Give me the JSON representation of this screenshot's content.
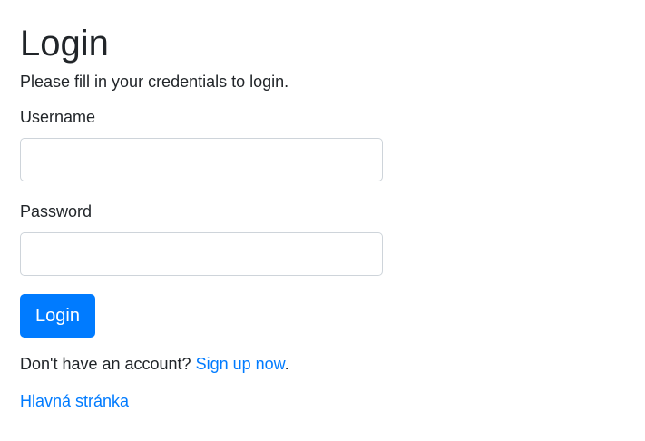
{
  "page": {
    "title": "Login",
    "subtitle": "Please fill in your credentials to login."
  },
  "form": {
    "username_label": "Username",
    "username_value": "",
    "password_label": "Password",
    "password_value": "",
    "submit_label": "Login"
  },
  "signup": {
    "prompt": "Don't have an account?",
    "link_label": "Sign up now",
    "suffix": "."
  },
  "home_link": "Hlavná stránka",
  "colors": {
    "accent": "#007bff",
    "text": "#212529",
    "border": "#ced4da"
  }
}
